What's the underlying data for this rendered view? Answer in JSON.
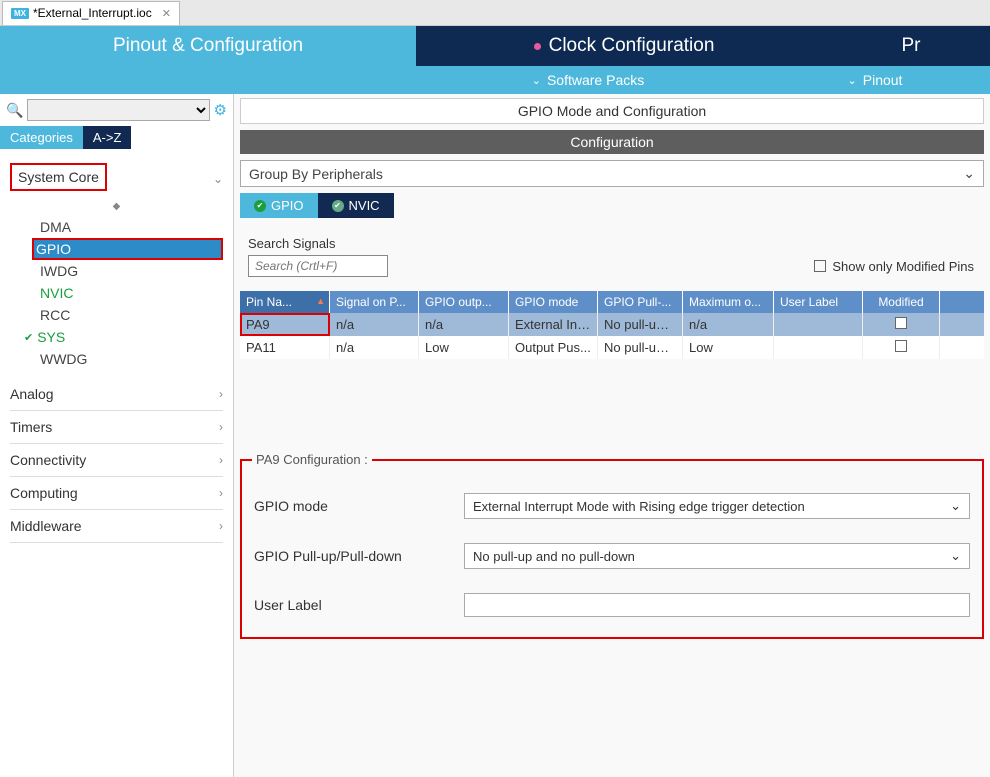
{
  "file_tab": {
    "icon_label": "MX",
    "name": "*External_Interrupt.ioc",
    "close": "✕"
  },
  "main_nav": {
    "tab1": "Pinout & Configuration",
    "tab2": "Clock Configuration",
    "tab3": "Pr"
  },
  "sub_nav": {
    "item1": "Software Packs",
    "item2": "Pinout"
  },
  "sidebar": {
    "cat_tab": "Categories",
    "az_tab": "A->Z",
    "groups": {
      "system_core": "System Core",
      "analog": "Analog",
      "timers": "Timers",
      "connectivity": "Connectivity",
      "computing": "Computing",
      "middleware": "Middleware"
    },
    "items": {
      "dma": "DMA",
      "gpio": "GPIO",
      "iwdg": "IWDG",
      "nvic": "NVIC",
      "rcc": "RCC",
      "sys": "SYS",
      "wwdg": "WWDG"
    }
  },
  "panel": {
    "title": "GPIO Mode and Configuration",
    "config_label": "Configuration",
    "group_by": "Group By Peripherals",
    "subtab_gpio": "GPIO",
    "subtab_nvic": "NVIC",
    "search_label": "Search Signals",
    "search_placeholder": "Search (Crtl+F)",
    "show_modified": "Show only Modified Pins"
  },
  "table": {
    "headers": {
      "pin": "Pin Na...",
      "signal": "Signal on P...",
      "output": "GPIO outp...",
      "mode": "GPIO mode",
      "pull": "GPIO Pull-...",
      "max": "Maximum o...",
      "label": "User Label",
      "modified": "Modified"
    },
    "rows": [
      {
        "pin": "PA9",
        "signal": "n/a",
        "output": "n/a",
        "mode": "External Int...",
        "pull": "No pull-up ...",
        "max": "n/a",
        "label": "",
        "modified": false
      },
      {
        "pin": "PA11",
        "signal": "n/a",
        "output": "Low",
        "mode": "Output Pus...",
        "pull": "No pull-up ...",
        "max": "Low",
        "label": "",
        "modified": false
      }
    ]
  },
  "form": {
    "title": "PA9 Configuration :",
    "gpio_mode_label": "GPIO mode",
    "gpio_mode_value": "External Interrupt Mode with Rising edge trigger detection",
    "pull_label": "GPIO Pull-up/Pull-down",
    "pull_value": "No pull-up and no pull-down",
    "user_label_label": "User Label",
    "user_label_value": ""
  }
}
